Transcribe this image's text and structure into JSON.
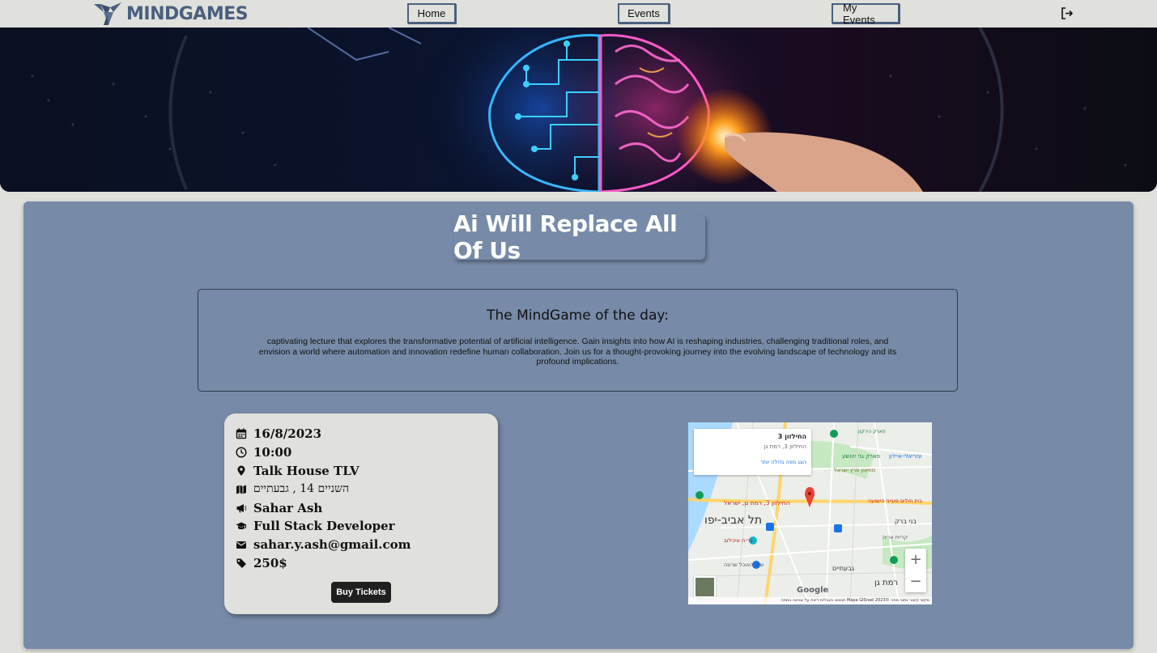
{
  "brand": {
    "name": "MINDGAMES",
    "color": "#4a5f7e"
  },
  "nav": {
    "home_label": "Home",
    "events_label": "Events",
    "my_events_label": "My Events",
    "logout_icon": "logout-icon"
  },
  "event": {
    "title": "Ai Will Replace All Of Us",
    "desc_heading": "The MindGame of the day:",
    "description": "captivating lecture that explores the transformative potential of artificial intelligence. Gain insights into how AI is reshaping industries, challenging traditional roles, and envision a world where automation and innovation redefine human collaboration. Join us for a thought-provoking journey into the evolving landscape of technology and its profound implications.",
    "date": "16/8/2023",
    "time": "10:00",
    "venue": "Talk House TLV",
    "address": "השניים 14 , גבעתיים",
    "speaker": "Sahar Ash",
    "speaker_role": "Full Stack Developer",
    "email": "sahar.y.ash@gmail.com",
    "price": "250$",
    "buy_label": "Buy Tickets"
  },
  "map": {
    "popup_title": "החילזון 3",
    "popup_subtitle": "החילזון 3, רמת גן",
    "popup_link": "הצג מפה גדולה יותר",
    "marker_label": "החילזון 3, רמת גן, ישראל",
    "city_label": "תל אביב-יפו",
    "label_bnei_brak": "בני ברק",
    "label_givatayim": "גבעתיים",
    "label_ramat_gan": "רמת גן",
    "label_yarkon": "פארק הירקון",
    "label_park": "פארק גני יהושע",
    "label_hospital": "בי״ח איכילוב",
    "label_museum": "מוזיאון ארץ ישראל",
    "label_ayalon": "עזריאלי-איילון",
    "label_ramat_hahayal": "קריית אריה",
    "label_market": "שוק האוכל שרונה",
    "label_hila": "בית חולים מעייני הישועה",
    "zoom_in": "+",
    "zoom_out": "−",
    "google": "Google",
    "footer": "מקשי קיצור   נתוני מפה ©2023 Mapa GISrael   תנאים והגבלות   דיווח על שגיאה במפה"
  },
  "colors": {
    "navbar_bg": "#e0e0dc",
    "card_bg": "#778ba8",
    "info_bg": "#e0e0dc",
    "button_bg": "#1f1f1f"
  }
}
